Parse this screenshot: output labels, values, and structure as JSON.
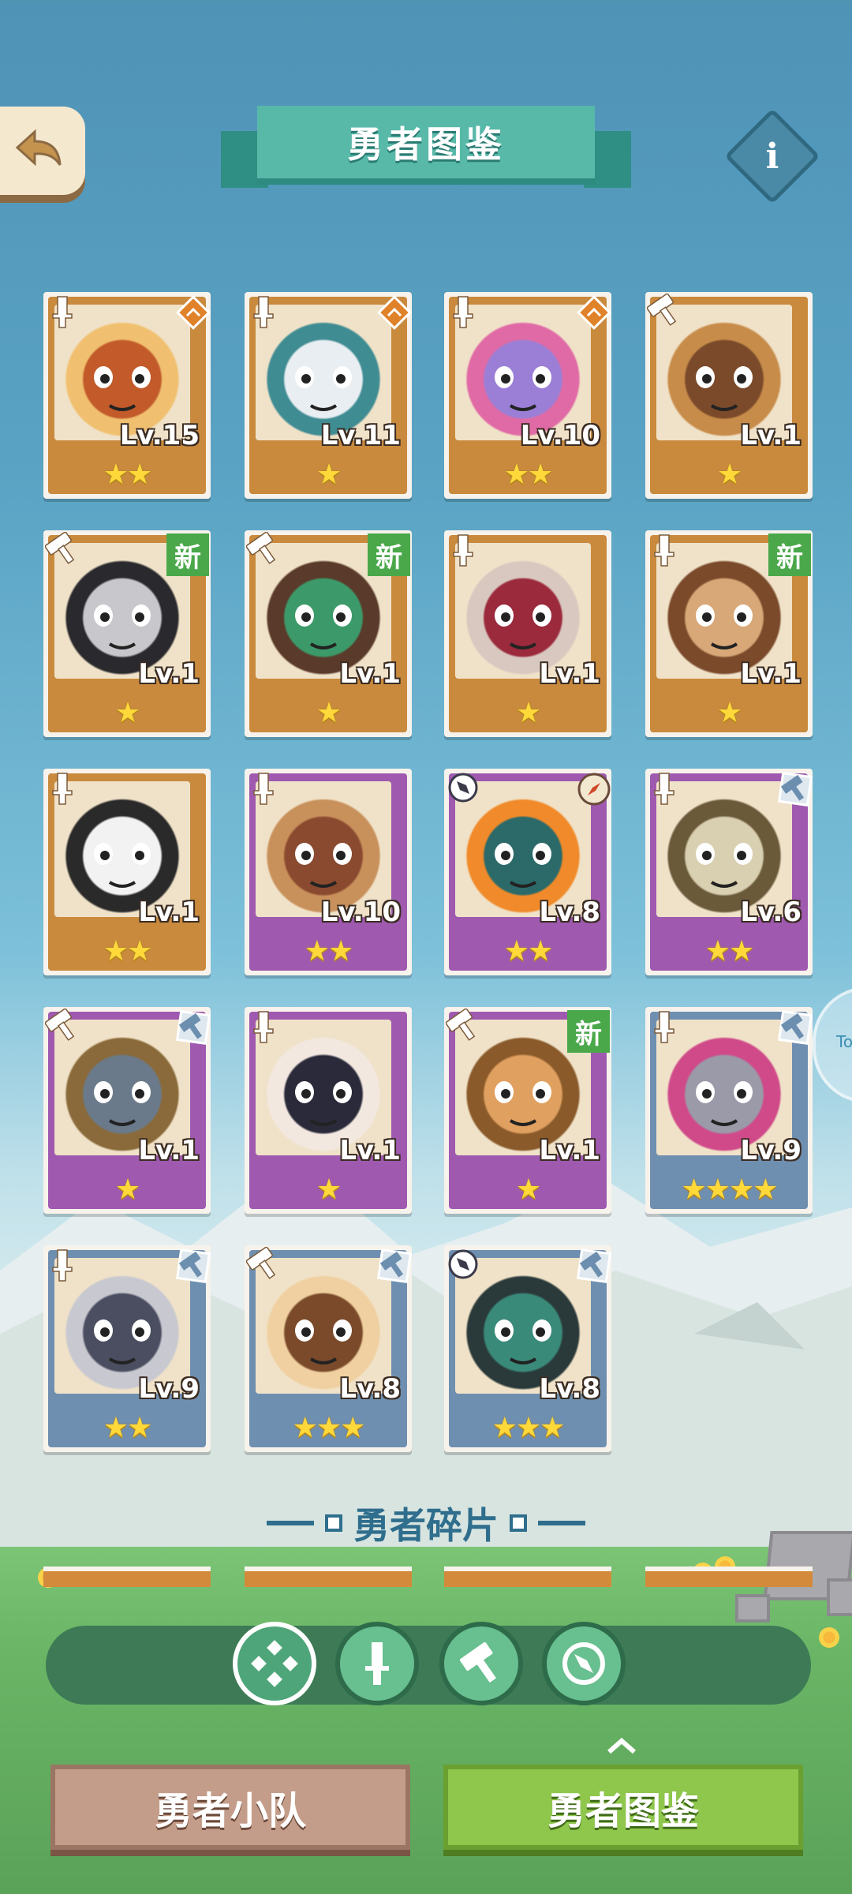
{
  "header": {
    "title": "勇者图鉴",
    "back_icon": "back-arrow-icon",
    "info_label": "i"
  },
  "side_peek_text": "To",
  "cards": [
    {
      "level": "Lv.15",
      "stars": 2,
      "frame": "orange",
      "cls": "sword",
      "corner": "orange-rank",
      "new": false,
      "art": "monkey",
      "c1": "#c25a2a",
      "c2": "#f0c070"
    },
    {
      "level": "Lv.11",
      "stars": 1,
      "frame": "orange",
      "cls": "sword",
      "corner": "orange-rank",
      "new": false,
      "art": "polar-bear",
      "c1": "#e9eef2",
      "c2": "#3f8c93"
    },
    {
      "level": "Lv.10",
      "stars": 2,
      "frame": "orange",
      "cls": "sword",
      "corner": "orange-rank",
      "new": false,
      "art": "elephant",
      "c1": "#9b7fd6",
      "c2": "#e06aa5"
    },
    {
      "level": "Lv.1",
      "stars": 1,
      "frame": "orange",
      "cls": "hammer",
      "corner": "none",
      "new": false,
      "art": "lion",
      "c1": "#7a4a2a",
      "c2": "#c88c4a"
    },
    {
      "level": "Lv.1",
      "stars": 1,
      "frame": "orange",
      "cls": "hammer",
      "corner": "none",
      "new": true,
      "art": "gorilla",
      "c1": "#c8c8cc",
      "c2": "#2a2a2e"
    },
    {
      "level": "Lv.1",
      "stars": 1,
      "frame": "orange",
      "cls": "hammer",
      "corner": "none",
      "new": true,
      "art": "crocodile",
      "c1": "#3c9a6a",
      "c2": "#5a3a2a"
    },
    {
      "level": "Lv.1",
      "stars": 1,
      "frame": "orange",
      "cls": "sword",
      "corner": "none",
      "new": false,
      "art": "dragon",
      "c1": "#9a2a3c",
      "c2": "#d8c8c0"
    },
    {
      "level": "Lv.1",
      "stars": 1,
      "frame": "orange",
      "cls": "sword",
      "corner": "none",
      "new": true,
      "art": "lynx",
      "c1": "#d8a878",
      "c2": "#7a4a2a"
    },
    {
      "level": "Lv.1",
      "stars": 2,
      "frame": "orange",
      "cls": "sword",
      "corner": "none",
      "new": false,
      "art": "panda",
      "c1": "#f2f2f2",
      "c2": "#2a2a2a"
    },
    {
      "level": "Lv.10",
      "stars": 2,
      "frame": "purple",
      "cls": "sword",
      "corner": "none",
      "new": false,
      "art": "lizard",
      "c1": "#8a4a30",
      "c2": "#c8905a"
    },
    {
      "level": "Lv.8",
      "stars": 2,
      "frame": "purple",
      "cls": "compass",
      "corner": "compass",
      "new": false,
      "art": "penguins",
      "c1": "#2c6a6a",
      "c2": "#f08a2a"
    },
    {
      "level": "Lv.6",
      "stars": 2,
      "frame": "purple",
      "cls": "sword",
      "corner": "hammer-blue",
      "new": false,
      "art": "goat",
      "c1": "#d8d0b0",
      "c2": "#6a5a3a"
    },
    {
      "level": "Lv.1",
      "stars": 1,
      "frame": "purple",
      "cls": "hammer",
      "corner": "hammer-blue",
      "new": false,
      "art": "boar",
      "c1": "#6a7a8a",
      "c2": "#8a6a3a"
    },
    {
      "level": "Lv.1",
      "stars": 1,
      "frame": "purple",
      "cls": "sword",
      "corner": "none",
      "new": false,
      "art": "sheep",
      "c1": "#2a2a3a",
      "c2": "#f2e8e0"
    },
    {
      "level": "Lv.1",
      "stars": 1,
      "frame": "purple",
      "cls": "hammer",
      "corner": "none",
      "new": true,
      "art": "pangolin",
      "c1": "#e0a060",
      "c2": "#8a5a2a"
    },
    {
      "level": "Lv.9",
      "stars": 4,
      "frame": "blue",
      "cls": "sword",
      "corner": "hammer-blue",
      "new": false,
      "art": "raccoon",
      "c1": "#9a9aa8",
      "c2": "#d04a8a"
    },
    {
      "level": "Lv.9",
      "stars": 2,
      "frame": "blue",
      "cls": "sword",
      "corner": "hammer-blue",
      "new": false,
      "art": "rabbit",
      "c1": "#4a4e60",
      "c2": "#c8c8d0"
    },
    {
      "level": "Lv.8",
      "stars": 3,
      "frame": "blue",
      "cls": "hammer",
      "corner": "hammer-blue",
      "new": false,
      "art": "deer-girl",
      "c1": "#7a4a2a",
      "c2": "#f0d0a0"
    },
    {
      "level": "Lv.8",
      "stars": 3,
      "frame": "blue",
      "cls": "compass",
      "corner": "hammer-blue",
      "new": false,
      "art": "frog",
      "c1": "#3a8a7a",
      "c2": "#2a3a3a"
    }
  ],
  "new_label": "新",
  "section": {
    "title": "勇者碎片"
  },
  "filters": [
    {
      "name": "filter-all-button",
      "icon": "all-diamonds-icon",
      "active": true
    },
    {
      "name": "filter-sword-button",
      "icon": "sword-icon",
      "active": false
    },
    {
      "name": "filter-hammer-button",
      "icon": "hammer-icon",
      "active": false
    },
    {
      "name": "filter-compass-button",
      "icon": "compass-icon",
      "active": false
    }
  ],
  "tabs": {
    "team": "勇者小队",
    "codex": "勇者图鉴"
  },
  "colors": {
    "frame_orange": "#c98a3e",
    "frame_purple": "#9f5ab0",
    "frame_blue": "#6f8fb0",
    "accent_teal": "#58b9a9",
    "new_green": "#4aa84a",
    "star_yellow": "#ffd83a"
  }
}
